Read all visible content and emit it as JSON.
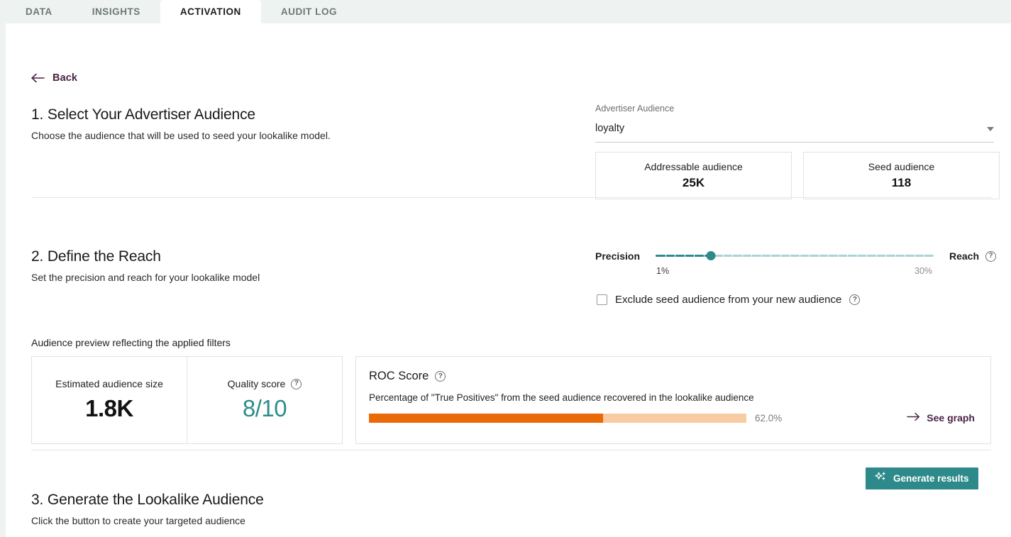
{
  "tabs": [
    {
      "label": "DATA",
      "active": false
    },
    {
      "label": "INSIGHTS",
      "active": false
    },
    {
      "label": "ACTIVATION",
      "active": true
    },
    {
      "label": "AUDIT LOG",
      "active": false
    }
  ],
  "back": {
    "label": "Back",
    "icon": "arrow-left-icon"
  },
  "section1": {
    "title": "1. Select Your Advertiser Audience",
    "subtitle": "Choose the audience that will be used to seed your lookalike model.",
    "field_label": "Advertiser Audience",
    "selected_value": "loyalty",
    "stats": [
      {
        "label": "Addressable audience",
        "value": "25K"
      },
      {
        "label": "Seed audience",
        "value": "118"
      }
    ]
  },
  "section2": {
    "title": "2. Define the Reach",
    "subtitle": "Set the precision and reach for your lookalike model",
    "slider": {
      "left_label": "Precision",
      "right_label": "Reach",
      "min_label": "1%",
      "max_label": "30%",
      "value_percent": 20,
      "tick_count": 29,
      "help_icon": "help-circle-icon",
      "track_color": "#a9d4d4",
      "fill_color": "#2f8a8a",
      "thumb_color": "#2e8a8a"
    },
    "exclude_checkbox": {
      "label": "Exclude seed audience from your new audience",
      "checked": false,
      "help_icon": "help-circle-icon"
    }
  },
  "preview": {
    "title": "Audience preview reflecting the applied filters",
    "cards": [
      {
        "label": "Estimated audience size",
        "value": "1.8K",
        "help": false
      },
      {
        "label": "Quality score",
        "value": "8/10",
        "help": true,
        "accent": "#2e8c8c"
      }
    ],
    "roc": {
      "title": "ROC Score",
      "help_icon": "help-circle-icon",
      "description": "Percentage of \"True Positives\" from the seed audience recovered in the lookalike audience",
      "percent_label": "62.0%",
      "percent_value": 62,
      "fill_color": "#ea6a09",
      "track_color": "#f8cba3",
      "link_label": "See graph",
      "link_icon": "arrow-right-icon"
    }
  },
  "section3": {
    "title": "3. Generate the Lookalike Audience",
    "subtitle": "Click the button to create your targeted audience",
    "button_label": "Generate results",
    "button_icon": "sparkle-icon",
    "button_color": "#2e8a8a"
  }
}
